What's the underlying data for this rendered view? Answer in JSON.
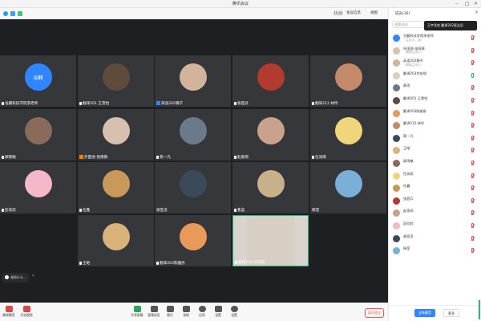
{
  "window": {
    "title": "腾讯会议"
  },
  "toolbar": {
    "time": "15:01",
    "meeting_info": "会议信息",
    "view": "视图"
  },
  "tiles": [
    {
      "name": "谷麒科技学院李老师",
      "avatar_text": "谷麒",
      "avatar_color": "#2f86ff",
      "badge": "mic"
    },
    {
      "name": "翻译201 王雪怡",
      "avatar_color": "#5e4b3c",
      "badge": "mic"
    },
    {
      "name": "英语202穆子",
      "avatar_color": "#d2b49c",
      "badge": "user"
    },
    {
      "name": "张茜兵",
      "avatar_color": "#b33a2e",
      "badge": "mic"
    },
    {
      "name": "翻译212 林玲",
      "avatar_color": "#c48a6a",
      "badge": "mic"
    },
    {
      "name": "顾雨敏",
      "avatar_color": "#8a6a5a",
      "badge": "mic"
    },
    {
      "name": "外国语-张雨薇",
      "avatar_color": "#d8c0b0",
      "badge": "host"
    },
    {
      "name": "蔡一凡",
      "avatar_color": "#6a7a8a",
      "badge": "mic"
    },
    {
      "name": "赵家雨",
      "avatar_color": "#c8a28a",
      "badge": "mic"
    },
    {
      "name": "任润雨",
      "avatar_color": "#f0d67a",
      "badge": "mic"
    },
    {
      "name": "彭欣欣",
      "avatar_color": "#f4b8c8",
      "badge": "mic"
    },
    {
      "name": "任鑫",
      "avatar_color": "#c89a5a",
      "badge": "mic"
    },
    {
      "name": "谢宣灵",
      "avatar_color": "#3a4a5a",
      "badge": "none"
    },
    {
      "name": "曹蓝",
      "avatar_color": "#c8b08a",
      "badge": "mic"
    },
    {
      "name": "杨莹",
      "avatar_color": "#7ab0d8",
      "badge": "none"
    },
    {
      "name": "王皓",
      "avatar_color": "#d8b47a",
      "badge": "mic"
    },
    {
      "name": "翻译203陈雅彤",
      "avatar_color": "#e89a5a",
      "badge": "mic"
    },
    {
      "name": "翻译203 付安琪",
      "avatar_color": "#d8cfc4",
      "badge": "mic",
      "speaking": true
    }
  ],
  "collapse": {
    "label": "谢雨什么..."
  },
  "bottombar": {
    "buttons": [
      {
        "label": "解除静音"
      },
      {
        "label": "开启视频"
      },
      {
        "label": "共享屏幕"
      },
      {
        "label": "管理成员"
      },
      {
        "label": "聊天"
      },
      {
        "label": "录制"
      },
      {
        "label": "应用"
      },
      {
        "label": "设置"
      },
      {
        "label": "设置"
      }
    ],
    "end_label": "离开会议"
  },
  "panel": {
    "title": "成员(36)",
    "search_placeholder": "搜索成员",
    "toast": "王宇洋欢 翻译202班全员",
    "members": [
      {
        "name": "谷麒科技学院李老师",
        "sub": "（主持人，我）",
        "color": "#2f86ff",
        "on": false
      },
      {
        "name": "外国语-张雨薇",
        "sub": "（联席主持人）",
        "color": "#d8c0b0",
        "on": false
      },
      {
        "name": "英语202穆子",
        "sub": "（联席主持人）",
        "color": "#d2b49c",
        "on": false
      },
      {
        "name": "翻译203付安琪",
        "sub": "",
        "color": "#d8cfc4",
        "on": true
      },
      {
        "name": "蔡雨",
        "sub": "",
        "color": "#6a7a8a",
        "on": false
      },
      {
        "name": "翻译201 王雪怡",
        "sub": "",
        "color": "#5e4b3c",
        "on": false
      },
      {
        "name": "翻译203陈雅彤",
        "sub": "",
        "color": "#e89a5a",
        "on": false
      },
      {
        "name": "翻译212 林玲",
        "sub": "",
        "color": "#c48a6a",
        "on": false
      },
      {
        "name": "蔡一凡",
        "sub": "",
        "color": "#3a4a5a",
        "on": false
      },
      {
        "name": "王皓",
        "sub": "",
        "color": "#d8b47a",
        "on": false
      },
      {
        "name": "顾雨敏",
        "sub": "",
        "color": "#8a6a5a",
        "on": false
      },
      {
        "name": "任润雨",
        "sub": "",
        "color": "#f0d67a",
        "on": false
      },
      {
        "name": "任鑫",
        "sub": "",
        "color": "#c89a5a",
        "on": false
      },
      {
        "name": "张茜兵",
        "sub": "",
        "color": "#b33a2e",
        "on": false
      },
      {
        "name": "赵家雨",
        "sub": "",
        "color": "#c8a28a",
        "on": false
      },
      {
        "name": "彭欣欣",
        "sub": "",
        "color": "#f4b8c8",
        "on": false
      },
      {
        "name": "谢宣灵",
        "sub": "",
        "color": "#3a4a5a",
        "on": false
      },
      {
        "name": "杨莹",
        "sub": "",
        "color": "#7ab0d8",
        "on": false
      }
    ],
    "mute_all": "全体静音",
    "more": "更多"
  }
}
